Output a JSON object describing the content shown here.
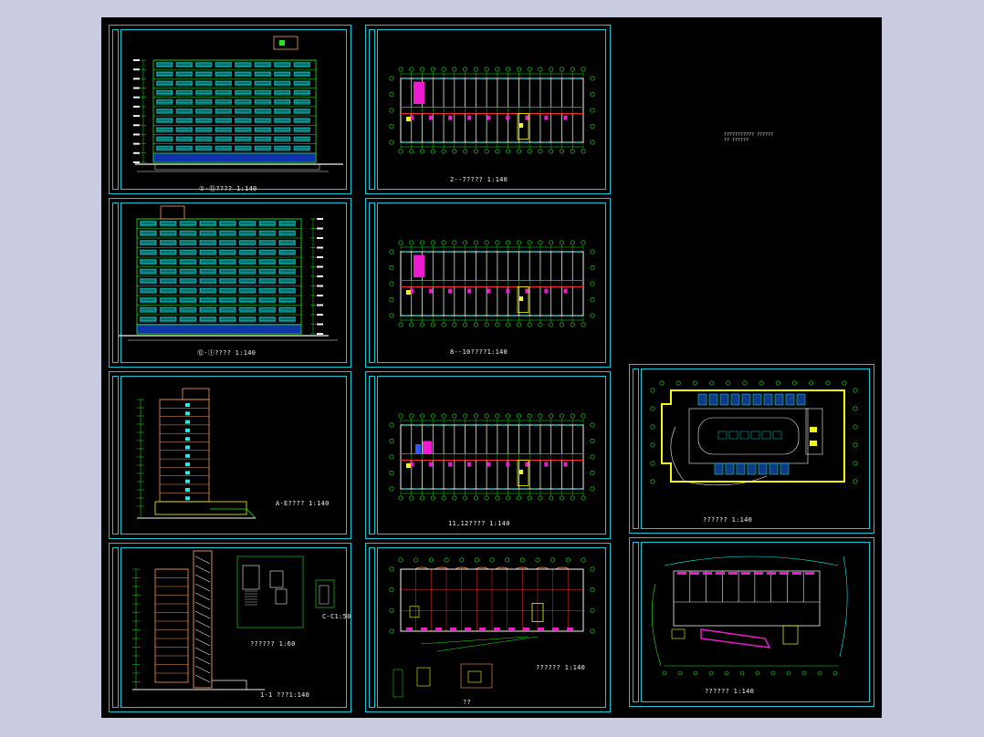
{
  "window": {
    "background": "#c9cbe0",
    "canvas_background": "#000000",
    "frame_color": "#16c9d8"
  },
  "sheets": {
    "elev_1": {
      "caption": "①-⑫????  1:140"
    },
    "elev_2": {
      "caption": "⑫-①????  1:140"
    },
    "elev_side": {
      "caption": "A-E???? 1:140"
    },
    "section": {
      "caption": "1-1 ???1:140",
      "detail_caption": "??????  1:60",
      "small_caption": "C-C1:50"
    },
    "plan_2_7": {
      "caption": "2--7????  1:140"
    },
    "plan_8_10": {
      "caption": "8--10????1:140"
    },
    "plan_11_12": {
      "caption": "11,12????  1:140"
    },
    "plan_1": {
      "caption": "??????  1:140",
      "small_caption": "??"
    },
    "plan_basement": {
      "caption": "??????  1:140"
    },
    "plan_site": {
      "caption": "??????  1:140"
    },
    "notes": {
      "line1": "??????????? ??????",
      "line2": "??  ??????"
    }
  },
  "colors": {
    "frame": "#16c9d8",
    "green": "#22e81f",
    "cyan": "#12f5f0",
    "yellow": "#f4f80a",
    "red": "#f22d2d",
    "magenta": "#ee1ad0",
    "white": "#f2f2f2",
    "orange": "#f49a5c",
    "blue": "#3355ff"
  }
}
